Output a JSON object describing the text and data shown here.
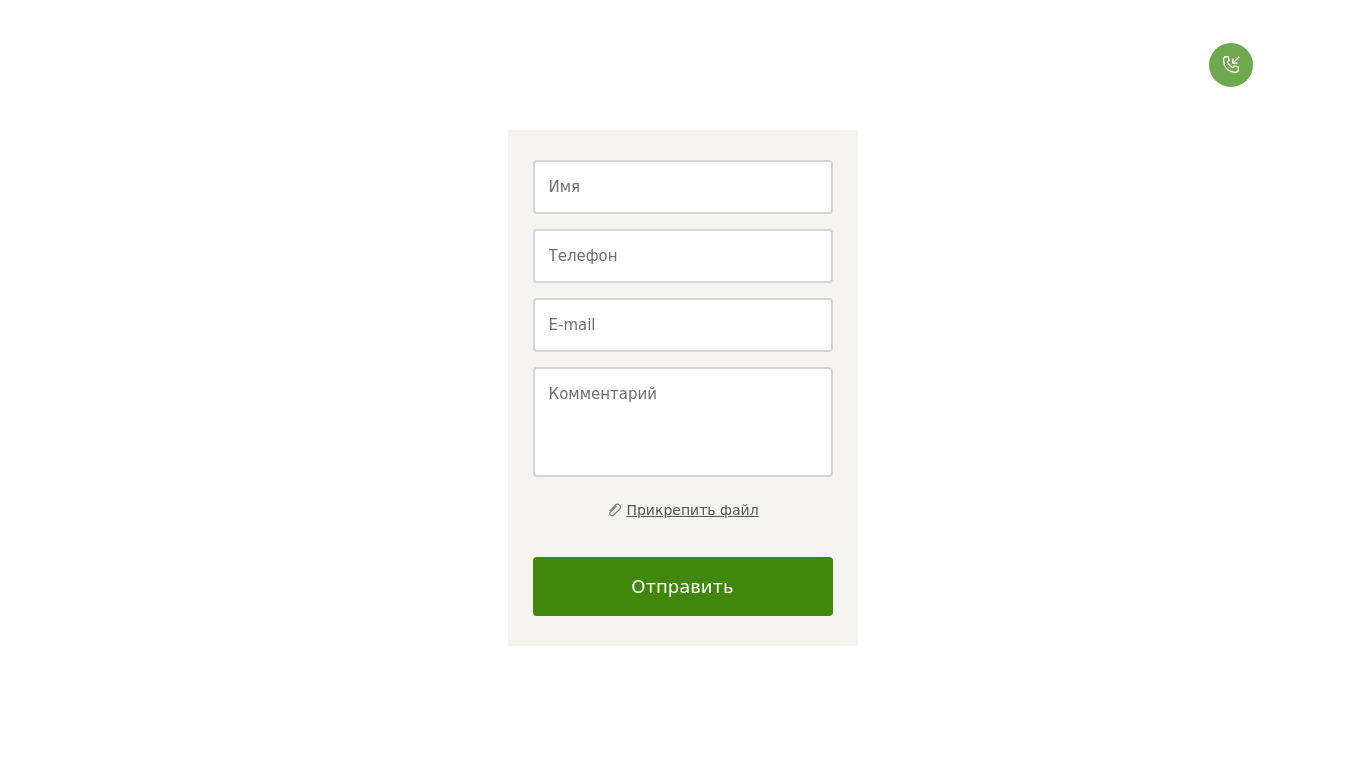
{
  "fields": [
    {
      "kind": "input",
      "placeholder": "Имя"
    },
    {
      "kind": "input",
      "placeholder": "Телефон"
    },
    {
      "kind": "input",
      "placeholder": "E-mail"
    },
    {
      "kind": "textarea",
      "placeholder": "Комментарий"
    }
  ],
  "attach_link": "Прикрепить файл",
  "submit_button": "Отправить"
}
